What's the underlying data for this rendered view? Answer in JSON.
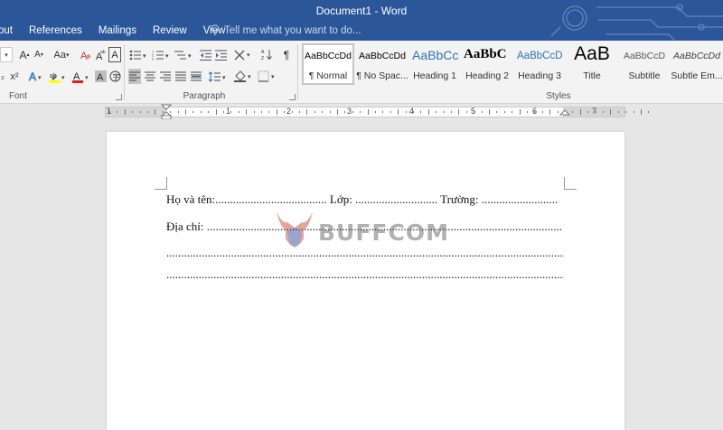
{
  "window": {
    "title": "Document1 - Word"
  },
  "tabs": [
    "out",
    "References",
    "Mailings",
    "Review",
    "View"
  ],
  "tell_me": {
    "placeholder": "Tell me what you want to do..."
  },
  "ribbon": {
    "groups": {
      "font": "Font",
      "paragraph": "Paragraph",
      "styles": "Styles"
    },
    "styles": [
      {
        "sample": "AaBbCcDd",
        "name": "¶ Normal",
        "selected": true,
        "color": "#000000"
      },
      {
        "sample": "AaBbCcDd",
        "name": "¶ No Spac...",
        "selected": false,
        "color": "#000000"
      },
      {
        "sample": "AaBbCc",
        "name": "Heading 1",
        "selected": false,
        "color": "#2e74b5"
      },
      {
        "sample": "AaBbC",
        "name": "Heading 2",
        "selected": false,
        "color": "#000000"
      },
      {
        "sample": "AaBbCcD",
        "name": "Heading 3",
        "selected": false,
        "color": "#2e74b5"
      },
      {
        "sample": "AaB",
        "name": "Title",
        "selected": false,
        "color": "#000000"
      },
      {
        "sample": "AaBbCcD",
        "name": "Subtitle",
        "selected": false,
        "color": "#5a5a5a"
      },
      {
        "sample": "AaBbCcDd",
        "name": "Subtle Em...",
        "selected": false,
        "color": "#404040"
      }
    ],
    "font_size_up": "A",
    "font_size_down": "A",
    "change_case": "Aa",
    "superscript": "x²",
    "font_color_sample": "A",
    "highlight_sample": "ab",
    "pilcrow": "¶"
  },
  "ruler": {
    "labels": [
      "1",
      "1",
      "2",
      "3",
      "4",
      "5",
      "6",
      "7"
    ]
  },
  "document": {
    "lines": [
      "Họ và tên:...................................... Lớp: ............................ Trường: ..........................",
      "Địa chỉ: .........................................................................................................................",
      "...........................................................................................................................................",
      "..........................................................................................................................................."
    ]
  },
  "watermark": {
    "text": "BUFFCOM"
  },
  "colors": {
    "accent": "#2b579a",
    "ribbon": "#f3f3f3",
    "workspace": "#e6e6e6"
  }
}
